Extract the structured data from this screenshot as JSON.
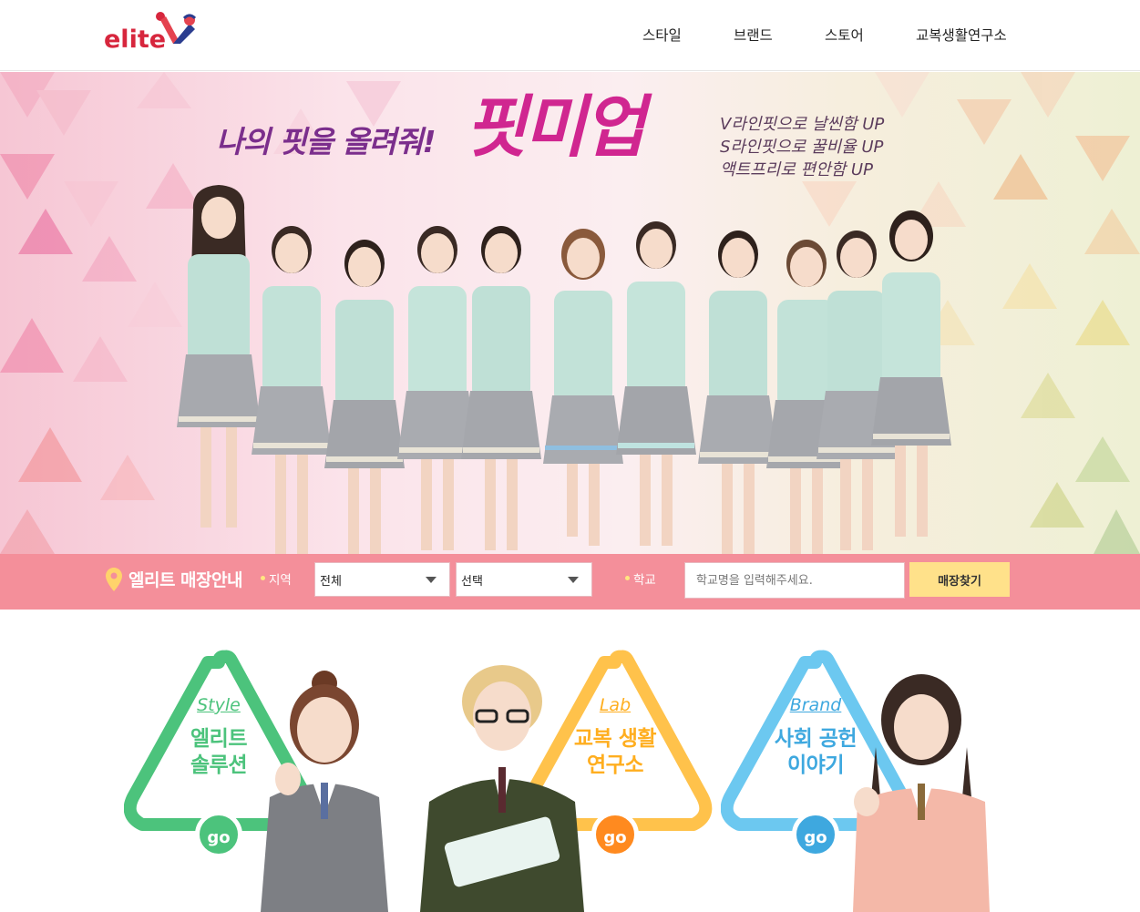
{
  "header": {
    "logo_text": "elite",
    "nav": [
      {
        "label": "스타일"
      },
      {
        "label": "브랜드"
      },
      {
        "label": "스토어"
      },
      {
        "label": "교복생활연구소"
      }
    ]
  },
  "hero": {
    "title_left": "나의 핏을 올려줘!",
    "title_main": "핏미업",
    "copy": [
      "V라인핏으로 날씬함 UP",
      "S라인핏으로 꿀비율 UP",
      "액트프리로 편안함 UP"
    ]
  },
  "store_search": {
    "title": "엘리트 매장안내",
    "region_label": "지역",
    "region_value": "전체",
    "district_value": "선택",
    "school_label": "학교",
    "school_placeholder": "학교명을 입력해주세요.",
    "search_label": "매장찾기"
  },
  "cards": [
    {
      "tag": "Style",
      "title_line1": "엘리트",
      "title_line2": "솔루션",
      "go_label": "go",
      "color": "#4cc37c"
    },
    {
      "tag": "Lab",
      "title_line1": "교복 생활",
      "title_line2": "연구소",
      "go_label": "go",
      "color": "#ffc24b"
    },
    {
      "tag": "Brand",
      "title_line1": "사회 공헌",
      "title_line2": "이야기",
      "go_label": "go",
      "color": "#6cc8f0"
    }
  ],
  "colors": {
    "brand_red": "#d7263d",
    "storebar": "#f48f9a",
    "search_button": "#ffe18a"
  }
}
